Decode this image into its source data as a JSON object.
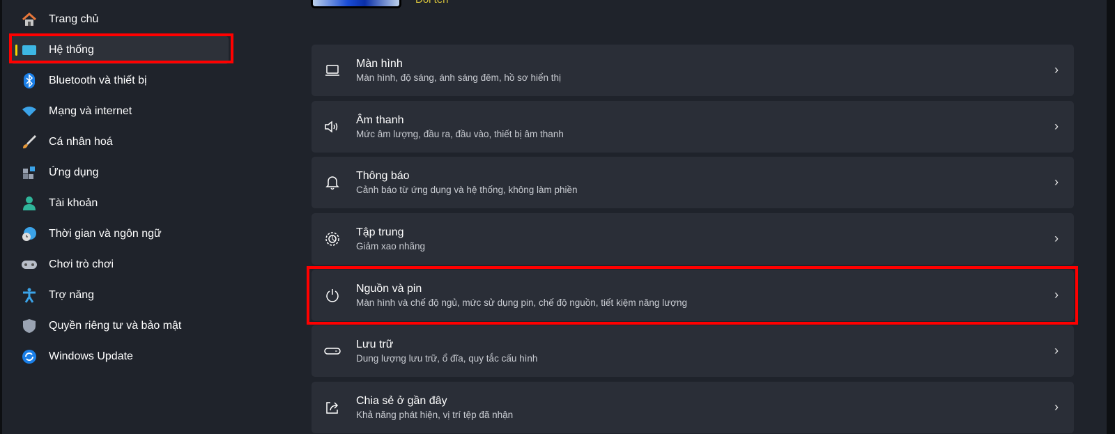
{
  "header": {
    "rename_label": "Đổi tên"
  },
  "sidebar": {
    "items": [
      {
        "label": "Trang chủ",
        "icon": "home-icon"
      },
      {
        "label": "Hệ thống",
        "icon": "monitor-icon",
        "selected": true
      },
      {
        "label": "Bluetooth và thiết bị",
        "icon": "bluetooth-icon"
      },
      {
        "label": "Mạng và internet",
        "icon": "wifi-icon"
      },
      {
        "label": "Cá nhân hoá",
        "icon": "brush-icon"
      },
      {
        "label": "Ứng dụng",
        "icon": "apps-icon"
      },
      {
        "label": "Tài khoản",
        "icon": "account-icon"
      },
      {
        "label": "Thời gian và ngôn ngữ",
        "icon": "globe-clock-icon"
      },
      {
        "label": "Chơi trò chơi",
        "icon": "gamepad-icon"
      },
      {
        "label": "Trợ năng",
        "icon": "accessibility-icon"
      },
      {
        "label": "Quyền riêng tư và bảo mật",
        "icon": "shield-icon"
      },
      {
        "label": "Windows Update",
        "icon": "update-icon"
      }
    ]
  },
  "main": {
    "items": [
      {
        "title": "Màn hình",
        "subtitle": "Màn hình, độ sáng, ánh sáng đêm, hồ sơ hiển thị",
        "icon": "laptop-icon"
      },
      {
        "title": "Âm thanh",
        "subtitle": "Mức âm lượng, đầu ra, đầu vào, thiết bị âm thanh",
        "icon": "speaker-icon"
      },
      {
        "title": "Thông báo",
        "subtitle": "Cảnh báo từ ứng dụng và hệ thống, không làm phiền",
        "icon": "bell-icon"
      },
      {
        "title": "Tập trung",
        "subtitle": "Giảm xao nhãng",
        "icon": "focus-icon"
      },
      {
        "title": "Nguồn và pin",
        "subtitle": "Màn hình và chế độ ngủ, mức sử dụng pin, chế độ nguồn, tiết kiệm năng lượng",
        "icon": "power-icon",
        "highlighted": true
      },
      {
        "title": "Lưu trữ",
        "subtitle": "Dung lượng lưu trữ, ổ đĩa, quy tắc cấu hình",
        "icon": "storage-icon"
      },
      {
        "title": "Chia sẻ ở gần đây",
        "subtitle": "Khả năng phát hiện, vị trí tệp đã nhận",
        "icon": "share-icon"
      }
    ]
  },
  "colors": {
    "accent": "#f5d400",
    "highlight": "#ff0000",
    "background": "#1f232b",
    "card": "#2a2e37"
  }
}
